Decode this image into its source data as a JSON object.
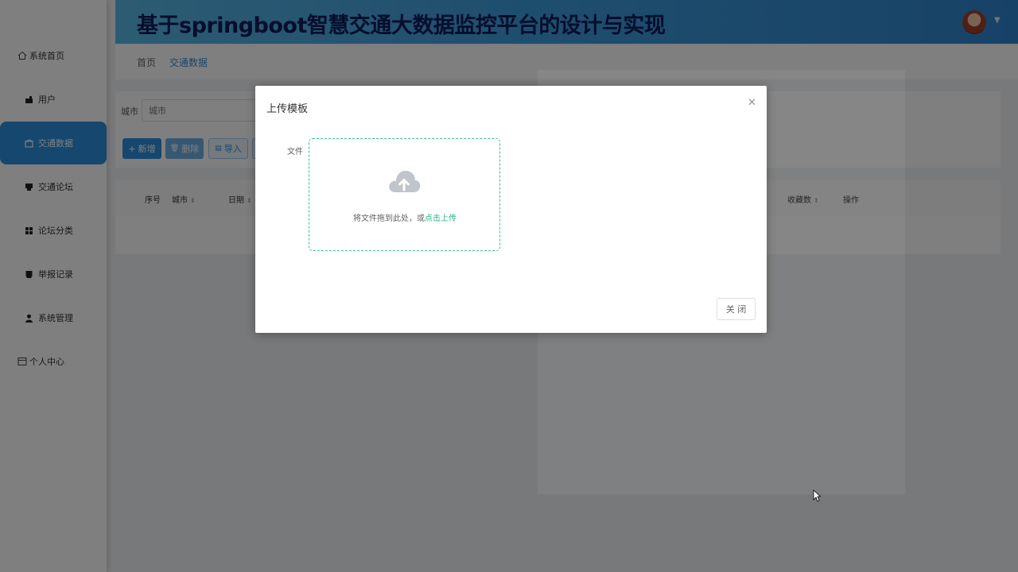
{
  "header": {
    "title": "基于springboot智慧交通大数据监控平台的设计与实现"
  },
  "sidebar": {
    "items": [
      {
        "label": "系统首页",
        "icon": "home-icon"
      },
      {
        "label": "用户",
        "icon": "user-icon"
      },
      {
        "label": "交通数据",
        "icon": "traffic-data-icon"
      },
      {
        "label": "交通论坛",
        "icon": "forum-icon"
      },
      {
        "label": "论坛分类",
        "icon": "category-icon"
      },
      {
        "label": "举报记录",
        "icon": "report-icon"
      },
      {
        "label": "系统管理",
        "icon": "admin-icon"
      },
      {
        "label": "个人中心",
        "icon": "profile-icon"
      }
    ]
  },
  "breadcrumb": {
    "home": "首页",
    "current": "交通数据"
  },
  "search": {
    "city_label": "城市",
    "city_placeholder": "城市"
  },
  "toolbar": {
    "add": "新增",
    "delete": "删除",
    "import": "导入"
  },
  "table": {
    "columns": {
      "index": "序号",
      "city": "城市",
      "date": "日期",
      "favorites": "收藏数",
      "actions": "操作"
    }
  },
  "dialog": {
    "title": "上传模板",
    "file_label": "文件",
    "upload_hint": "将文件拖到此处，或",
    "upload_link": "点击上传",
    "close_button": "关 闭"
  },
  "colors": {
    "accent": "#2c8fdc",
    "upload_border": "#3dbb95",
    "upload_link": "#2bb489",
    "title_text": "#0d1a5a"
  }
}
